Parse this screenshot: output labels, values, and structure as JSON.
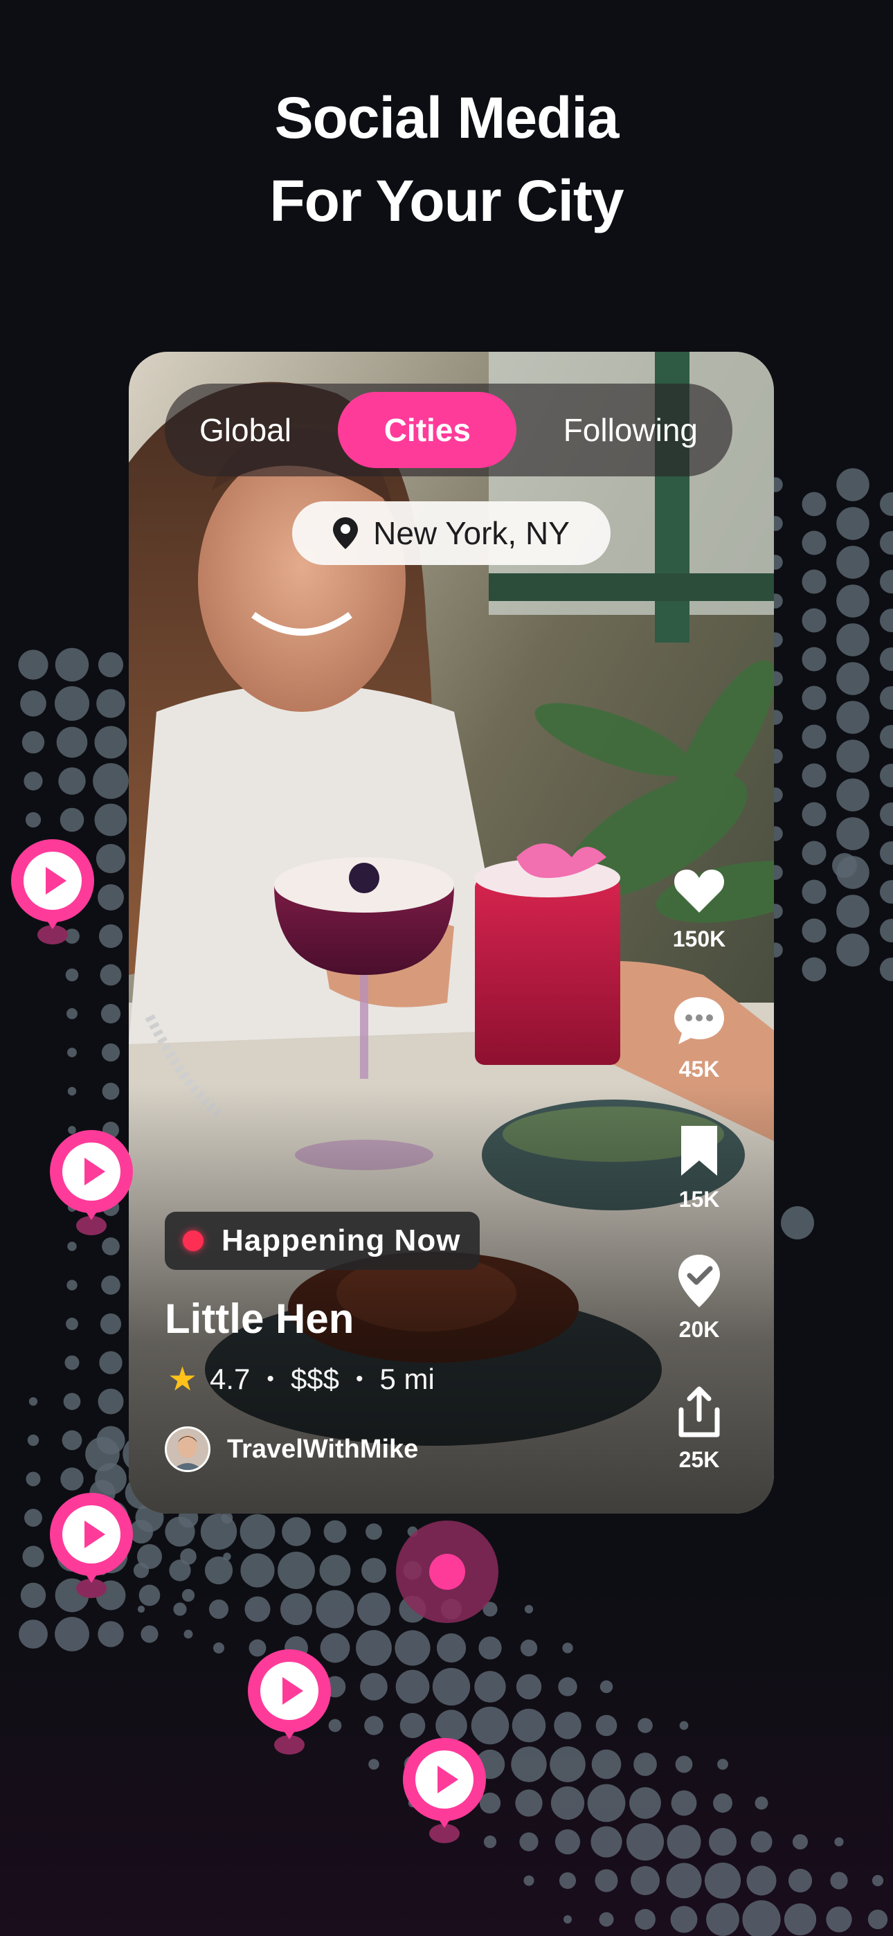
{
  "headline": {
    "line1": "Social Media",
    "line2": "For Your City"
  },
  "feed_tabs": {
    "items": [
      "Global",
      "Cities",
      "Following"
    ],
    "active": "Cities"
  },
  "location": {
    "label": "New York, NY",
    "icon": "location-pin-icon"
  },
  "actions": [
    {
      "name": "like",
      "icon": "heart-icon",
      "count": "150K"
    },
    {
      "name": "comment",
      "icon": "comment-icon",
      "count": "45K"
    },
    {
      "name": "save",
      "icon": "bookmark-icon",
      "count": "15K"
    },
    {
      "name": "checkin",
      "icon": "check-pin-icon",
      "count": "20K"
    },
    {
      "name": "share",
      "icon": "share-icon",
      "count": "25K"
    }
  ],
  "post": {
    "badge": "Happening Now",
    "venue": "Little Hen",
    "rating": "4.7",
    "price": "$$$",
    "distance": "5 mi",
    "separator": "•",
    "author": "TravelWithMike"
  },
  "colors": {
    "accent": "#ff3b9a",
    "background": "#0d0e13",
    "dots": "#5b6570",
    "live": "#ff2f53",
    "star": "#ffc21a"
  }
}
